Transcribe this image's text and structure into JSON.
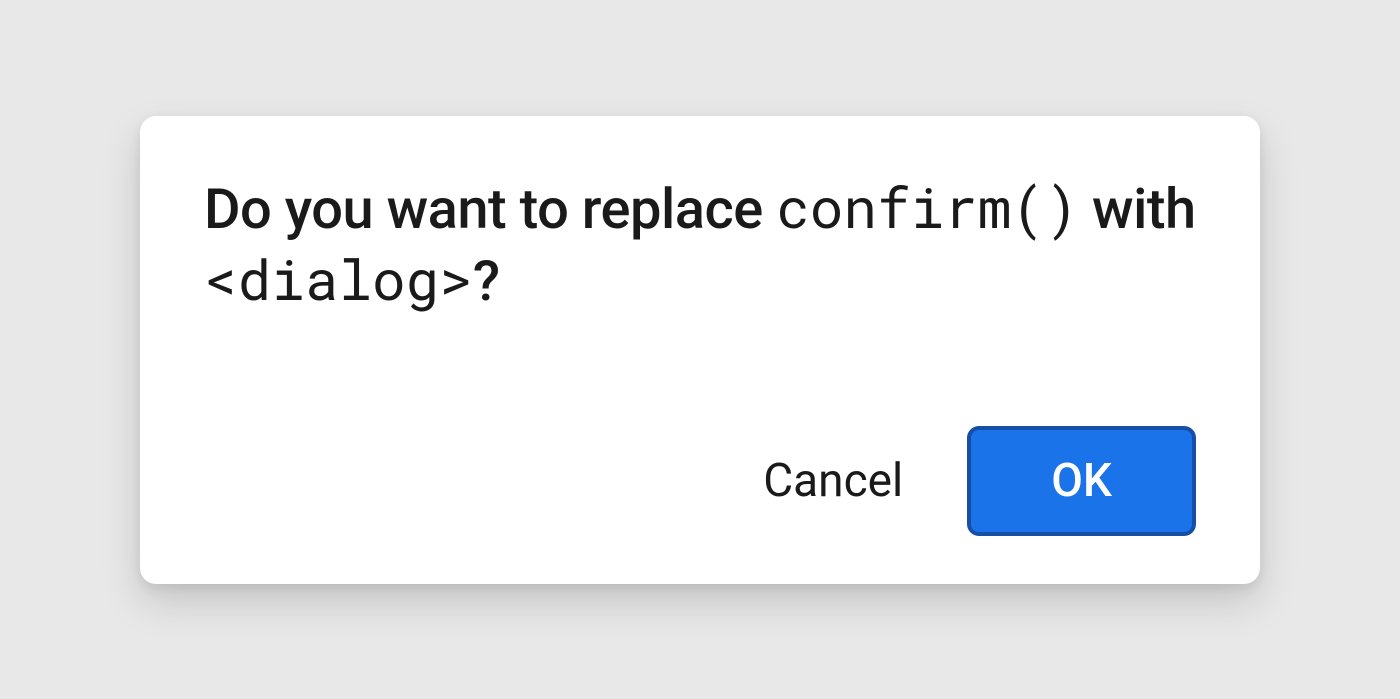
{
  "dialog": {
    "message_prefix": "Do you want to replace ",
    "code1": "confirm()",
    "message_mid": " with ",
    "code2": "<dialog>",
    "message_suffix": "?",
    "cancel_label": "Cancel",
    "ok_label": "OK"
  },
  "colors": {
    "background": "#e8e8e8",
    "dialog_bg": "#ffffff",
    "text": "#1a1a1a",
    "primary": "#1a73e8",
    "primary_border": "#174ea6"
  }
}
